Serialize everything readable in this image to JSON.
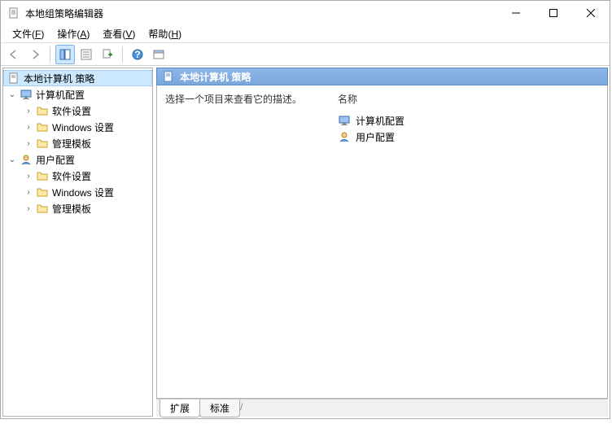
{
  "window": {
    "title": "本地组策略编辑器"
  },
  "menu": {
    "file": {
      "label": "文件",
      "hotkey": "F"
    },
    "action": {
      "label": "操作",
      "hotkey": "A"
    },
    "view": {
      "label": "查看",
      "hotkey": "V"
    },
    "help": {
      "label": "帮助",
      "hotkey": "H"
    }
  },
  "tree": {
    "root": {
      "label": "本地计算机 策略"
    },
    "computer": {
      "label": "计算机配置",
      "children": {
        "software": "软件设置",
        "windows": "Windows 设置",
        "admin": "管理模板"
      }
    },
    "user": {
      "label": "用户配置",
      "children": {
        "software": "软件设置",
        "windows": "Windows 设置",
        "admin": "管理模板"
      }
    }
  },
  "detail": {
    "header": "本地计算机 策略",
    "description": "选择一个项目来查看它的描述。",
    "column_name": "名称",
    "items": {
      "computer": "计算机配置",
      "user": "用户配置"
    }
  },
  "tabs": {
    "extended": "扩展",
    "standard": "标准"
  }
}
